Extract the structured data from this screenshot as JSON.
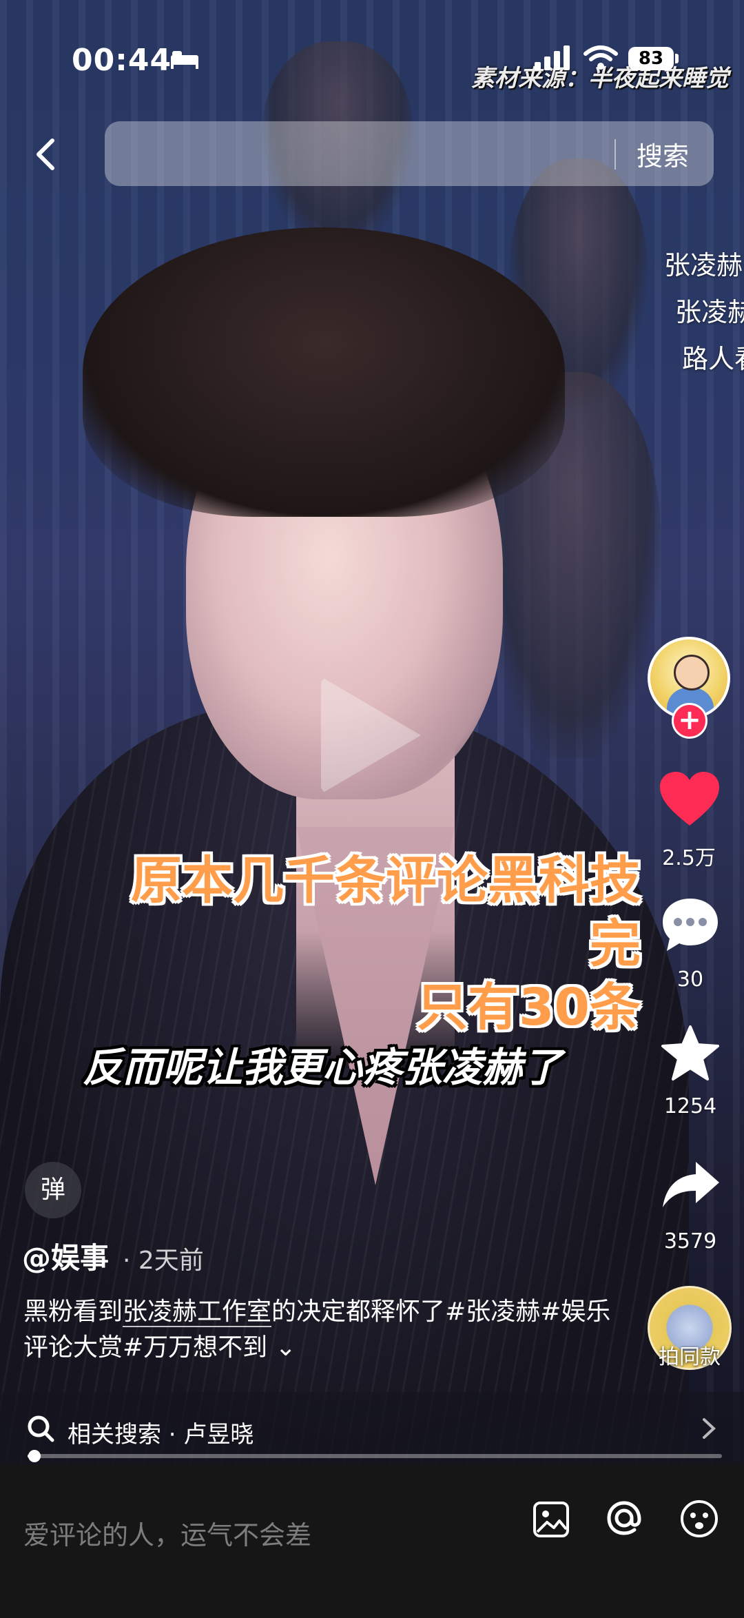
{
  "status_bar": {
    "time": "00:44",
    "battery": "83",
    "watermark": "素材来源：半夜起来睡觉"
  },
  "search": {
    "placeholder": "",
    "button_label": "搜索"
  },
  "video": {
    "edge_text": [
      "张凌赫",
      "张凌赫",
      "路人看"
    ],
    "caption_orange_line1": "原本几千条评论黑科技完",
    "caption_orange_line2": "只有30条",
    "caption_white": "反而呢让我更心疼张凌赫了"
  },
  "actions": {
    "likes": "2.5万",
    "comments": "30",
    "favorites": "1254",
    "shares": "3579",
    "make_same_label": "拍同款"
  },
  "post": {
    "danmaku_label": "弹",
    "author": "@娱事",
    "time": "· 2天前",
    "desc_part1": "黑粉看到",
    "desc_link": "张凌赫工作室",
    "desc_part2": "的决定都释怀了#张凌赫#娱乐评论大赏#万万想不到",
    "desc_more": "⌄"
  },
  "related": {
    "label": "相关搜索 · 卢昱晓"
  },
  "progress": {
    "fraction": 0.01
  },
  "comment_bar": {
    "placeholder": "爱评论的人，运气不会差"
  },
  "colors": {
    "like": "#fe2c55",
    "caption_orange": "#ff9d4a"
  }
}
